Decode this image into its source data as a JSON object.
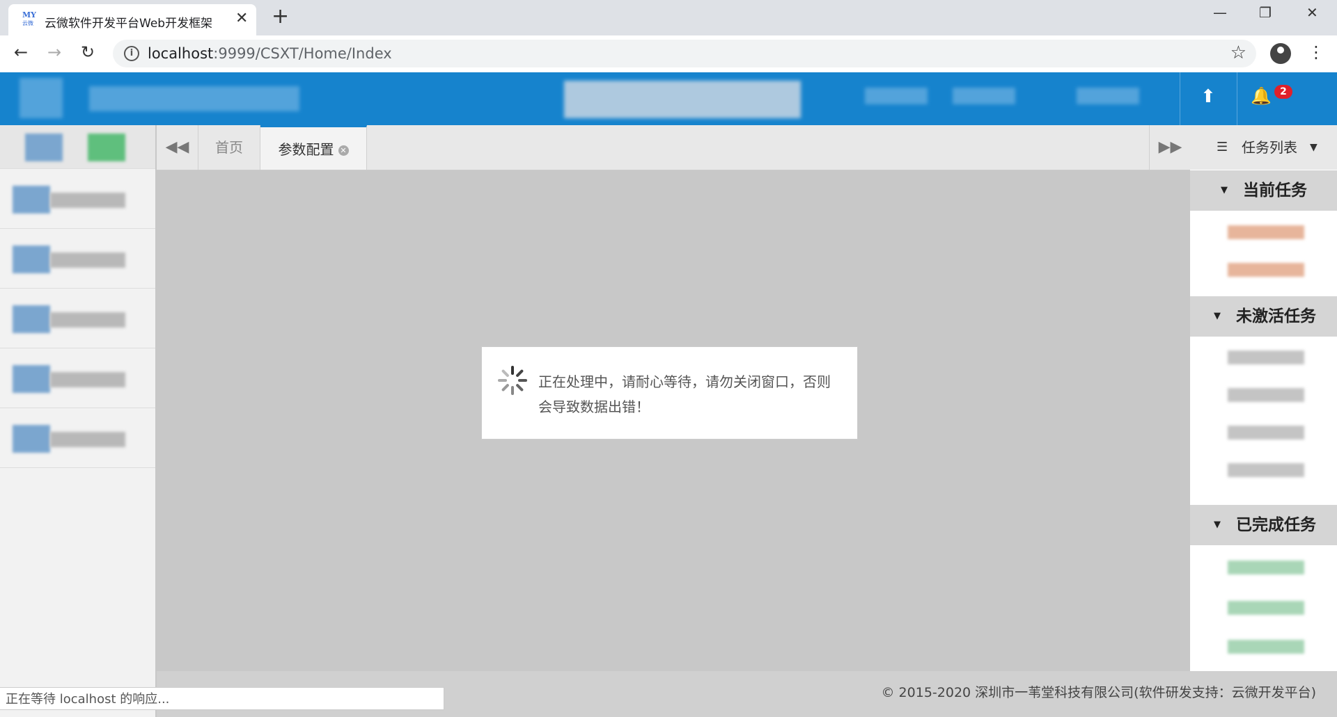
{
  "browser": {
    "tab_title": "云微软件开发平台Web开发框架",
    "favicon_top": "MY",
    "favicon_bottom": "云微",
    "url_host": "localhost",
    "url_path": ":9999/CSXT/Home/Index",
    "status_text": "正在等待 localhost 的响应..."
  },
  "header": {
    "notification_count": "2"
  },
  "tabbar": {
    "tabs": [
      {
        "label": "首页",
        "active": false
      },
      {
        "label": "参数配置",
        "active": true
      }
    ]
  },
  "task_panel": {
    "title": "任务列表",
    "sections": [
      {
        "label": "当前任务",
        "color": "#e7b59b"
      },
      {
        "label": "未激活任务",
        "color": "#c4c4c4"
      },
      {
        "label": "已完成任务",
        "color": "#a9d6b7"
      }
    ]
  },
  "dialog": {
    "message": "正在处理中，请耐心等待，请勿关闭窗口，否则会导致数据出错！"
  },
  "footer": {
    "copyright": "© 2015-2020 深圳市一苇堂科技有限公司(软件研发支持：云微开发平台)"
  },
  "colors": {
    "header_bg": "#1683cd",
    "badge": "#e0202a",
    "overlay": "#c8c8c8"
  }
}
